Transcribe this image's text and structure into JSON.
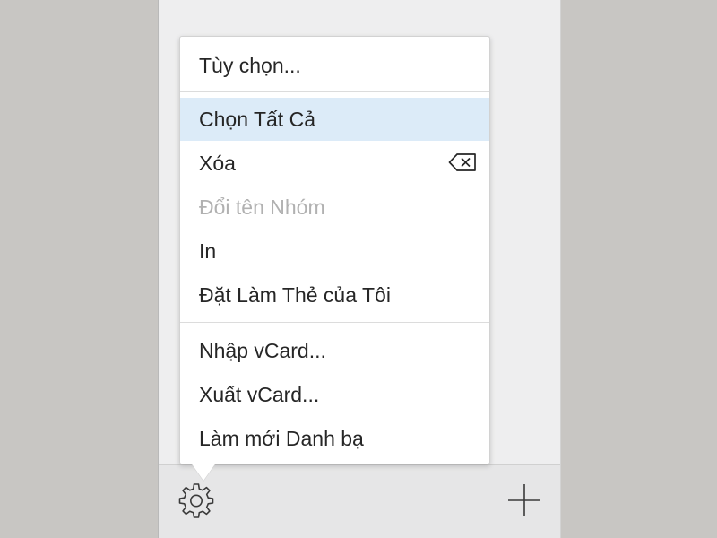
{
  "menu": {
    "items": [
      {
        "label": "Tùy chọn..."
      },
      {
        "label": "Chọn Tất Cả",
        "highlighted": true
      },
      {
        "label": "Xóa",
        "icon": "delete-backspace-icon"
      },
      {
        "label": "Đổi tên Nhóm",
        "disabled": true
      },
      {
        "label": "In"
      },
      {
        "label": "Đặt Làm Thẻ của Tôi"
      },
      {
        "label": "Nhập vCard..."
      },
      {
        "label": "Xuất vCard..."
      },
      {
        "label": "Làm mới Danh bạ"
      }
    ]
  },
  "toolbar": {
    "gear_icon": "gear-icon",
    "add_icon": "plus-icon"
  },
  "colors": {
    "highlight": "#dcebf8",
    "disabled_text": "#b1b1b1",
    "text": "#262626",
    "background": "#c8c6c3"
  }
}
